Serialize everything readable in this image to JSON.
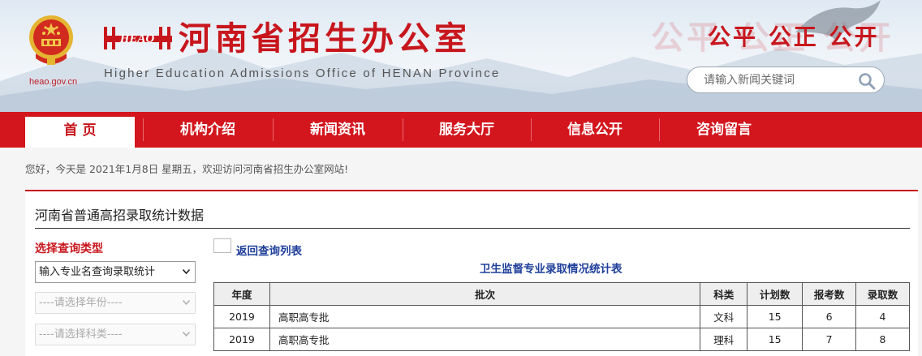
{
  "header": {
    "domain": "heao.gov.cn",
    "logo_text": "HEAO",
    "title": "河南省招生办公室",
    "subtitle": "Higher Education Admissions Office of HENAN Province",
    "slogan": "公平 公正 公开",
    "search_placeholder": "请输入新闻关键词",
    "brand_color": "#c8161d"
  },
  "nav": {
    "items": [
      "首 页",
      "机构介绍",
      "新闻资讯",
      "服务大厅",
      "信息公开",
      "咨询留言"
    ],
    "active": "首 页"
  },
  "greeting": "您好，今天是 2021年1月8日 星期五，欢迎访问河南省招生办公室网站!",
  "panel": {
    "title": "河南省普通高招录取统计数据",
    "query_label": "选择查询类型",
    "query_type": "输入专业名查询录取统计",
    "year_placeholder": "----请选择年份----",
    "subject_placeholder": "----请选择科类----",
    "back_link": "返回查询列表",
    "table_title": "卫生监督专业录取情况统计表",
    "table": {
      "headers": [
        "年度",
        "批次",
        "科类",
        "计划数",
        "报考数",
        "录取数"
      ],
      "rows": [
        [
          "2019",
          "高职高专批",
          "文科",
          "15",
          "6",
          "4"
        ],
        [
          "2019",
          "高职高专批",
          "理科",
          "15",
          "7",
          "8"
        ]
      ]
    }
  }
}
